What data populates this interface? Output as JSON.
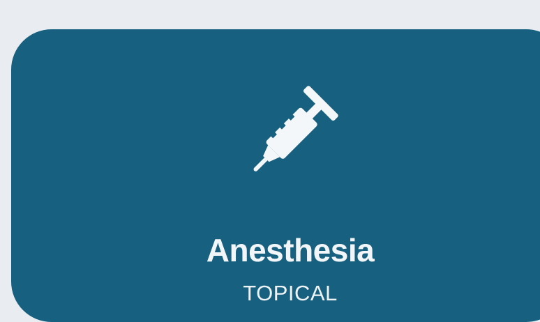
{
  "card": {
    "icon": "syringe-icon",
    "title": "Anesthesia",
    "subtitle": "TOPICAL",
    "colors": {
      "card_background": "#17607f",
      "page_background": "#e9edf1",
      "text": "#f3f6f8"
    }
  }
}
